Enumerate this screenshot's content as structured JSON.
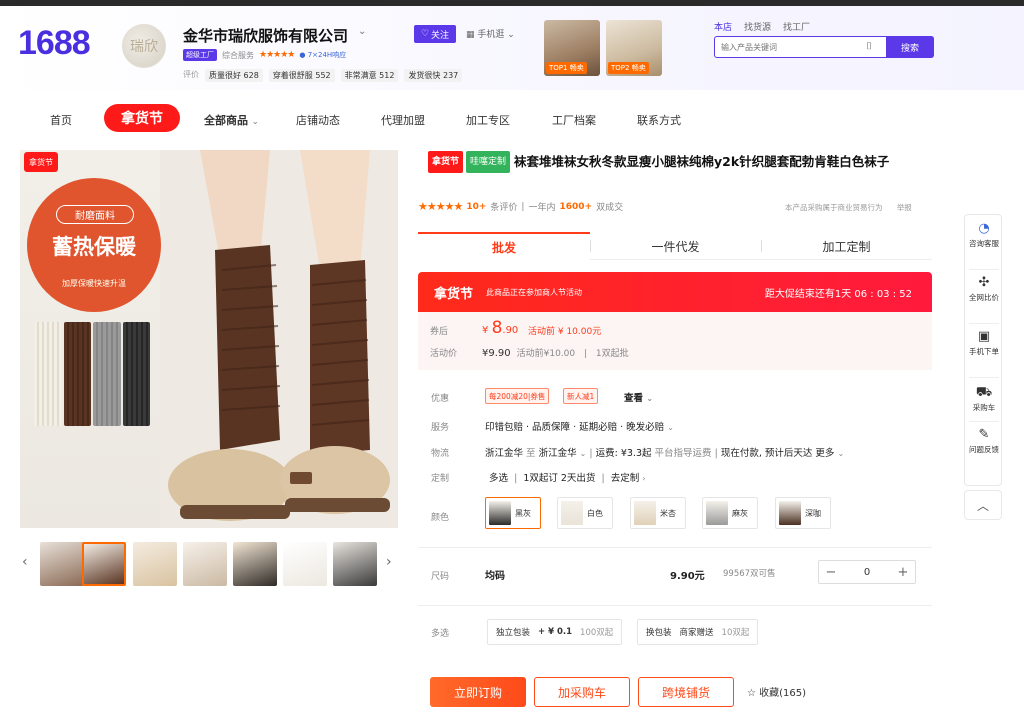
{
  "header": {
    "logo": "1688",
    "avatar_text": "瑞欣",
    "shop_name": "金华市瑞欣服饰有限公司",
    "follow_label": "关注",
    "mobile_label": "手机逛",
    "badge_label": "超级工厂",
    "service_label": "综合服务",
    "service_stars": "★★★★★",
    "guarantee_label": "7×24H响应",
    "rating_label": "评价",
    "ratings": [
      "质量很好 628",
      "穿着很舒服 552",
      "非常满意 512",
      "发货很快 237"
    ],
    "top_items": [
      {
        "tag": "TOP1",
        "label": "畅卖"
      },
      {
        "tag": "TOP2",
        "label": "畅卖"
      }
    ],
    "search_tabs": [
      "本店",
      "找货源",
      "找工厂"
    ],
    "search_placeholder": "输入产品关键词",
    "search_button": "搜索"
  },
  "nav": {
    "items": [
      "首页",
      "全部商品",
      "店铺动态",
      "代理加盟",
      "加工专区",
      "工厂档案",
      "联系方式"
    ],
    "promo": "拿货节"
  },
  "gallery": {
    "promo_tag": "拿货节",
    "circle_top": "耐磨面料",
    "circle_main": "蓄热保暖",
    "circle_bottom": "加厚保暖快速升温",
    "prev": "‹",
    "next": "›"
  },
  "product": {
    "tag_promo": "拿货节",
    "tag_green": "哇噻定制",
    "title": "袜套堆堆袜女秋冬款显瘦小腿袜纯棉y2k针织腿套配勃肯鞋白色袜子",
    "stars": "★★★★★",
    "reviews_count": "10+",
    "reviews_label": "条评价",
    "year_label": "一年内",
    "sold_count": "1600+",
    "sold_label": "双成交",
    "report_note": "本产品采购属于商业贸易行为",
    "report_link": "举报"
  },
  "tabs": [
    "批发",
    "一件代发",
    "加工定制"
  ],
  "promo_banner": {
    "logo": "拿货节",
    "message": "此商品正在参加商人节活动",
    "countdown": "距大促结束还有1天 06 : 03 : 52"
  },
  "price": {
    "coupon_label": "券后",
    "coupon_currency": "¥",
    "coupon_price": "8",
    "coupon_decimal": ".90",
    "pre_activity": "活动前 ¥ 10.00元",
    "activity_label": "活动价",
    "activity_price": "¥9.90",
    "activity_before": "活动前¥10.00",
    "moq": "1双起批"
  },
  "details": {
    "discount_label": "优惠",
    "coupons": [
      "每200减20|券售",
      "新人减1"
    ],
    "view_label": "查看",
    "service_label": "服务",
    "service_text": "印错包赔 · 品质保障 · 延期必赔 · 晚发必赔",
    "logistics_label": "物流",
    "ship_from": "浙江金华",
    "ship_to_word": "至",
    "ship_to": "浙江金华",
    "freight_label": "运费:",
    "freight_value": "¥3.3起",
    "freight_note": "平台指导运费",
    "pay_note": "现在付款, 预计后天达",
    "more_label": "更多",
    "custom_label": "定制",
    "custom_multi": "多选",
    "custom_moq": "1双起订",
    "custom_ship": "2天出货",
    "custom_link": "去定制"
  },
  "colors": {
    "label": "颜色",
    "options": [
      {
        "name": "黑灰",
        "hex": "#2b2b2b"
      },
      {
        "name": "白色",
        "hex": "#f1ede6"
      },
      {
        "name": "米杏",
        "hex": "#e5d7bf"
      },
      {
        "name": "麻灰",
        "hex": "#9a9a9a"
      },
      {
        "name": "深咖",
        "hex": "#4a3022"
      }
    ],
    "accent": "#ff6a00"
  },
  "size": {
    "label": "尺码",
    "name": "均码",
    "price": "9.90元",
    "stock": "99567双可售",
    "minus": "−",
    "qty": "0",
    "plus": "+"
  },
  "options": {
    "label": "多选",
    "items": [
      {
        "name": "独立包装",
        "price": "+ ¥ 0.1",
        "moq": "100双起"
      },
      {
        "name": "换包装",
        "price": "商家赠送",
        "moq": "10双起"
      }
    ]
  },
  "actions": {
    "buy": "立即订购",
    "cart": "加采购车",
    "cross": "跨境铺货",
    "favorite": "收藏(165)"
  },
  "side": {
    "items": [
      "咨询客服",
      "全网比价",
      "手机下单",
      "采购车",
      "问题反馈"
    ]
  }
}
